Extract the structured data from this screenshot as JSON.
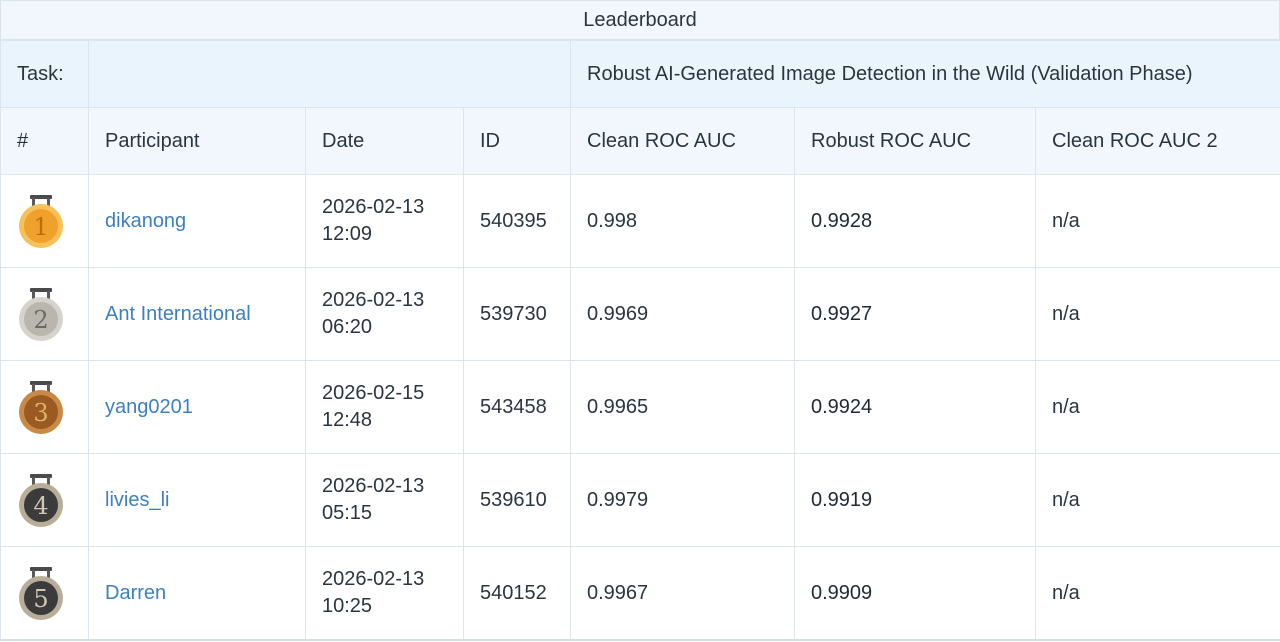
{
  "leaderboard": {
    "title": "Leaderboard",
    "task_label": "Task:",
    "task_name": "Robust AI-Generated Image Detection in the Wild (Validation Phase)",
    "columns": [
      "#",
      "Participant",
      "Date",
      "ID",
      "Clean ROC AUC",
      "Robust ROC AUC",
      "Clean ROC AUC 2"
    ],
    "rows": [
      {
        "rank": "1",
        "medal": "gold-medal-icon",
        "participant": "dikanong",
        "date": "2026-02-13",
        "time": "12:09",
        "id": "540395",
        "clean_auc": "0.998",
        "robust_auc": "0.9928",
        "clean_auc_2": "n/a"
      },
      {
        "rank": "2",
        "medal": "silver-medal-icon",
        "participant": "Ant International",
        "date": "2026-02-13",
        "time": "06:20",
        "id": "539730",
        "clean_auc": "0.9969",
        "robust_auc": "0.9927",
        "clean_auc_2": "n/a"
      },
      {
        "rank": "3",
        "medal": "bronze-medal-icon",
        "participant": "yang0201",
        "date": "2026-02-15",
        "time": "12:48",
        "id": "543458",
        "clean_auc": "0.9965",
        "robust_auc": "0.9924",
        "clean_auc_2": "n/a"
      },
      {
        "rank": "4",
        "medal": "dark-medal-icon",
        "participant": "livies_li",
        "date": "2026-02-13",
        "time": "05:15",
        "id": "539610",
        "clean_auc": "0.9979",
        "robust_auc": "0.9919",
        "clean_auc_2": "n/a"
      },
      {
        "rank": "5",
        "medal": "dark-medal-icon",
        "participant": "Darren",
        "date": "2026-02-13",
        "time": "10:25",
        "id": "540152",
        "clean_auc": "0.9967",
        "robust_auc": "0.9909",
        "clean_auc_2": "n/a"
      }
    ]
  },
  "colors": {
    "header_bg": "#f1f7fd",
    "task_bg": "#eaf4fd",
    "link": "#3d7fbf",
    "border": "#dde5ec",
    "gold": "#f0a12c",
    "silver": "#b9b6ae",
    "bronze": "#9a5a22",
    "dark_medal": "#3b3b3b"
  }
}
